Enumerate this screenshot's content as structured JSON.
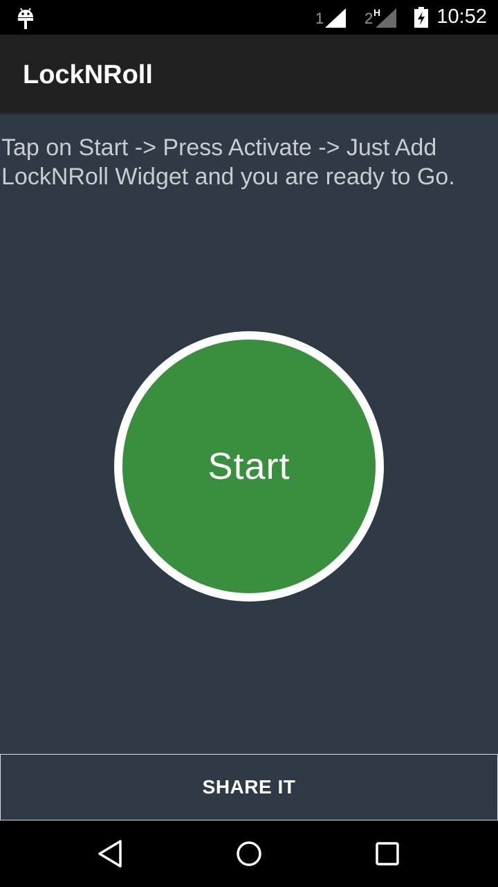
{
  "status_bar": {
    "sim1_label": "1",
    "sim2_label": "2",
    "sim2_network": "H",
    "time": "10:52",
    "icons": [
      "android-debug-icon",
      "signal-icon",
      "signal-icon",
      "battery-charging-icon"
    ]
  },
  "app_bar": {
    "title": "LockNRoll"
  },
  "main": {
    "instructions": "Tap on Start -> Press Activate -> Just Add LockNRoll Widget and you are ready to Go.",
    "start_label": "Start",
    "share_label": "SHARE IT"
  },
  "nav_bar": {
    "icons": [
      "back-icon",
      "home-icon",
      "recents-icon"
    ]
  },
  "colors": {
    "background": "#2f3a46",
    "app_bar": "#212121",
    "start_green": "#3a8f3e",
    "text_muted": "#c9ccd0"
  }
}
